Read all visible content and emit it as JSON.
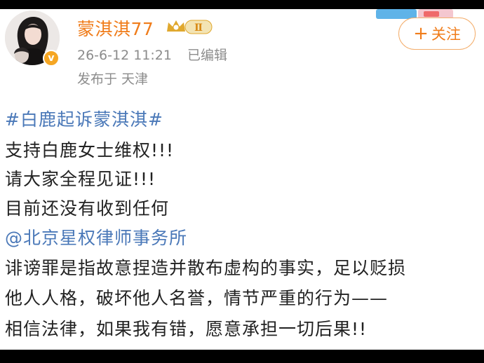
{
  "post": {
    "author": {
      "name": "蒙淇淇77",
      "level_badge": "Ⅱ",
      "verified_icon": "v-badge-icon",
      "verified_mark": "v"
    },
    "meta": {
      "timestamp": "26-6-12 11:21",
      "edited_label": "已编辑",
      "location_prefix": "发布于",
      "location": "天津"
    },
    "follow_button": {
      "icon": "plus-icon",
      "label": "关注"
    },
    "content": {
      "hashtag": "#白鹿起诉蒙淇淇#",
      "lines": [
        "支持白鹿女士维权!!!",
        "请大家全程见证!!!",
        "目前还没有收到任何"
      ],
      "mention": "@北京星权律师事务所",
      "closing_lines": [
        "诽谤罪是指故意捏造并散布虚构的事实，足以贬损",
        "他人人格，破坏他人名誉，情节严重的行为——",
        "相信法律，如果我有错，愿意承担一切后果!!"
      ]
    },
    "colors": {
      "accent": "#f07c1a",
      "link": "#4a78b8",
      "meta_text": "#8c8c8c",
      "body_text": "#222222",
      "verified": "#f5a623"
    }
  }
}
